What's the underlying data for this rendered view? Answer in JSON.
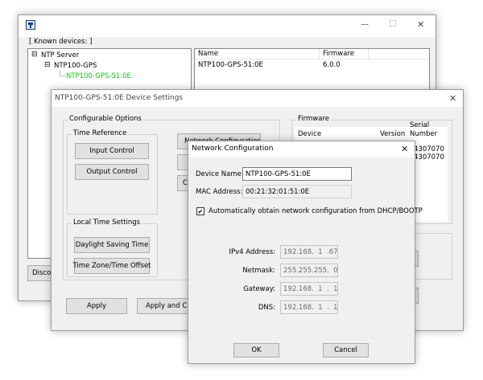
{
  "main_window": {
    "min_glyph": "—",
    "max_glyph": "☐",
    "close_glyph": "✕",
    "known_devices_label": "[ Known devices: ]",
    "tree": {
      "expander": "⊟",
      "root": "NTP Server",
      "group": "NTP100-GPS",
      "device": "NTP100-GPS-51:0E"
    },
    "list": {
      "headers": [
        "Name",
        "Firmware"
      ],
      "rows": [
        {
          "name": "NTP100-GPS-51:0E",
          "firmware": "6.0.0"
        }
      ]
    },
    "discover_partial": "Disco"
  },
  "device_settings": {
    "title": "NTP100-GPS-51:0E  Device Settings",
    "close_glyph": "✕",
    "configurable_options_label": "Configurable Options",
    "time_reference_label": "Time Reference",
    "input_control_label": "Input Control",
    "output_control_label": "Output Control",
    "network_config_btn_partial": "Network Configuration",
    "co_partial": "Co",
    "local_time_label": "Local Time Settings",
    "daylight_saving_label": "Daylight Saving Time",
    "timezone_label": "Time Zone/Time Offset",
    "firmware_label": "Firmware",
    "fw_headers": {
      "device": "Device",
      "version": "Version",
      "serial": "Serial\nNumber"
    },
    "fw_serials": [
      "4307070",
      "4307070"
    ],
    "apply_label": "Apply",
    "apply_close_label": "Apply and Close"
  },
  "network_config": {
    "title": "Network Configuration",
    "close_glyph": "✕",
    "device_name_label": "Device Name:",
    "device_name_value": "NTP100-GPS-51:0E",
    "mac_label": "MAC Address:",
    "mac_value": "00:21:32:01:51:0E",
    "check_mark": "✔",
    "dhcp_label": "Automatically obtain network configuration from DHCP/BOOTP",
    "dhcp_checked": true,
    "ipv4_label": "IPv4 Address:",
    "ipv4_value": "192.168.  1  .67",
    "netmask_label": "Netmask:",
    "netmask_value": "255.255.255.  0",
    "gateway_label": "Gateway:",
    "gateway_value": "192.168.  1  .  1",
    "dns_label": "DNS:",
    "dns_value": "192.168.  1  .  1",
    "ok_label": "OK",
    "cancel_label": "Cancel"
  }
}
